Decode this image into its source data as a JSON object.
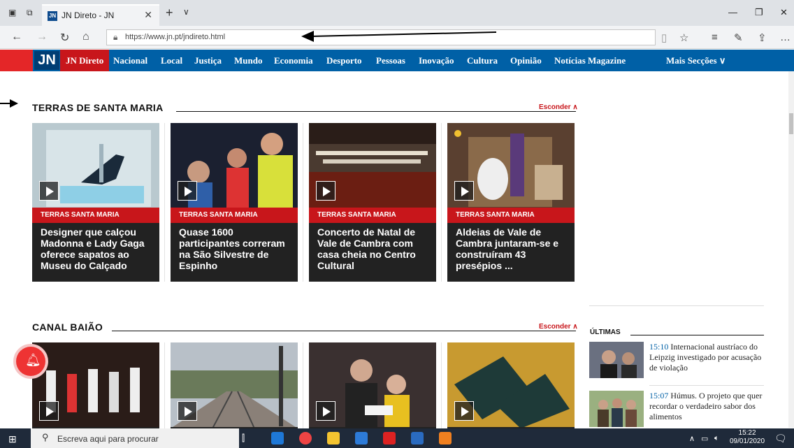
{
  "browser": {
    "tab_title": "JN Direto - JN",
    "favicon_text": "JN",
    "url": "https://www.jn.pt/jndireto.html"
  },
  "site_nav": {
    "logo": "JN",
    "active": "JN Direto",
    "items": [
      "Nacional",
      "Local",
      "Justiça",
      "Mundo",
      "Economia",
      "Desporto",
      "Pessoas",
      "Inovação",
      "Cultura",
      "Opinião",
      "Notícias Magazine"
    ],
    "more": "Mais Secções"
  },
  "sections": [
    {
      "title": "TERRAS DE SANTA MARIA",
      "hide_label": "Esconder",
      "cards": [
        {
          "tag": "TERRAS SANTA MARIA",
          "headline": "Designer que calçou Madonna e Lady Gaga oferece sapatos ao Museu do Calçado"
        },
        {
          "tag": "TERRAS SANTA MARIA",
          "headline": "Quase 1600 participantes correram na São Silvestre de Espinho"
        },
        {
          "tag": "TERRAS SANTA MARIA",
          "headline": "Concerto de Natal de Vale de Cambra com casa cheia no Centro Cultural"
        },
        {
          "tag": "TERRAS SANTA MARIA",
          "headline": "Aldeias de Vale de Cambra juntaram-se e construíram 43 presépios ..."
        }
      ]
    },
    {
      "title": "CANAL BAIÃO",
      "hide_label": "Esconder",
      "cards": [
        {},
        {},
        {},
        {}
      ]
    }
  ],
  "sidebar": {
    "title": "ÚLTIMAS",
    "items": [
      {
        "time": "15:10",
        "text": "Internacional austríaco do Leipzig investigado por acusação de violação"
      },
      {
        "time": "15:07",
        "text": "Húmus. O projeto que quer recordar o verdadeiro sabor dos alimentos"
      }
    ]
  },
  "taskbar": {
    "search_placeholder": "Escreva aqui para procurar",
    "time": "15:22",
    "date": "09/01/2020"
  },
  "colors": {
    "nav_blue": "#0060a6",
    "jn_red": "#c8161b"
  }
}
